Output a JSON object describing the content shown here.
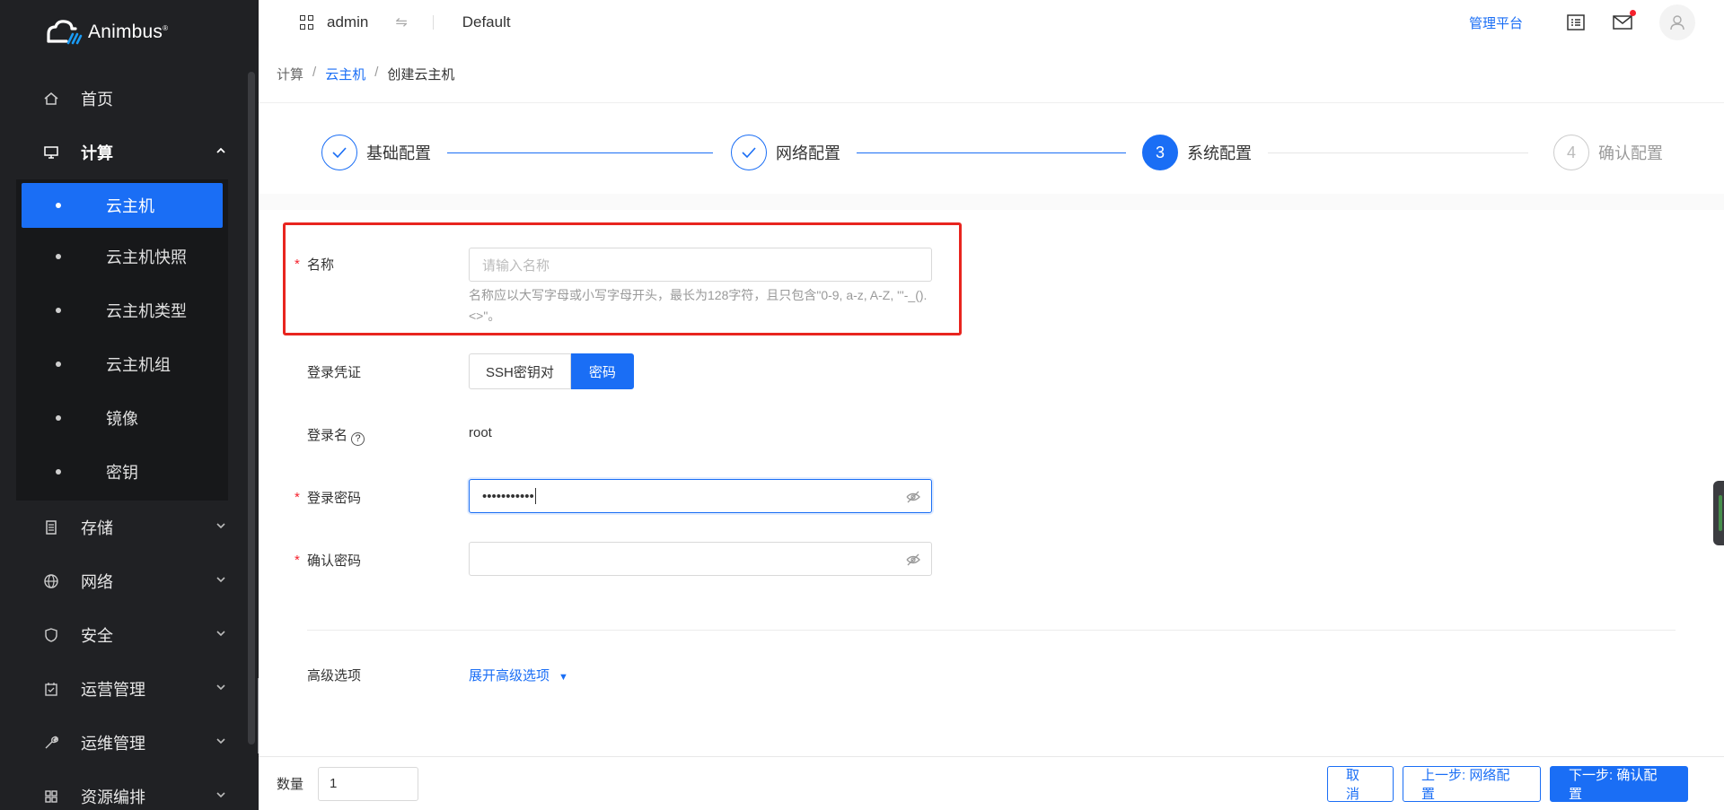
{
  "brand": {
    "name": "Animbus",
    "mark": "®"
  },
  "sidebar": {
    "items": [
      {
        "label": "首页",
        "icon": "home-icon"
      },
      {
        "label": "计算",
        "icon": "monitor-icon",
        "expanded": true,
        "children": [
          "云主机",
          "云主机快照",
          "云主机类型",
          "云主机组",
          "镜像",
          "密钥"
        ],
        "active_child": "云主机"
      },
      {
        "label": "存储",
        "icon": "storage-icon"
      },
      {
        "label": "网络",
        "icon": "globe-icon"
      },
      {
        "label": "安全",
        "icon": "shield-icon"
      },
      {
        "label": "运营管理",
        "icon": "calendar-icon"
      },
      {
        "label": "运维管理",
        "icon": "wrench-icon"
      },
      {
        "label": "资源编排",
        "icon": "grid-icon"
      }
    ]
  },
  "topbar": {
    "user": "admin",
    "project": "Default",
    "admin_link": "管理平台"
  },
  "breadcrumb": {
    "root": "计算",
    "parent": "云主机",
    "current": "创建云主机"
  },
  "steps": [
    {
      "label": "基础配置",
      "status": "done"
    },
    {
      "label": "网络配置",
      "status": "done"
    },
    {
      "label": "系统配置",
      "status": "current",
      "number": "3"
    },
    {
      "label": "确认配置",
      "status": "wait",
      "number": "4"
    }
  ],
  "form": {
    "name_label": "名称",
    "name_placeholder": "请输入名称",
    "name_help": "名称应以大写字母或小写字母开头，最长为128字符，且只包含\"0-9, a-z, A-Z, \"'-_().<>\"。",
    "credential_label": "登录凭证",
    "credential_options": [
      "SSH密钥对",
      "密码"
    ],
    "credential_selected": "密码",
    "login_name_label": "登录名",
    "login_name_value": "root",
    "password_label": "登录密码",
    "password_value": "•••••••••••",
    "confirm_password_label": "确认密码",
    "advanced_label": "高级选项",
    "advanced_link": "展开高级选项"
  },
  "bottom": {
    "quantity_label": "数量",
    "quantity_value": "1",
    "cancel": "取 消",
    "prev": "上一步: 网络配置",
    "next": "下一步: 确认配置"
  },
  "colors": {
    "primary": "#1a6ef5",
    "sidebar_bg": "#202124",
    "danger": "#f5222d",
    "highlight_box": "#e8251f"
  }
}
